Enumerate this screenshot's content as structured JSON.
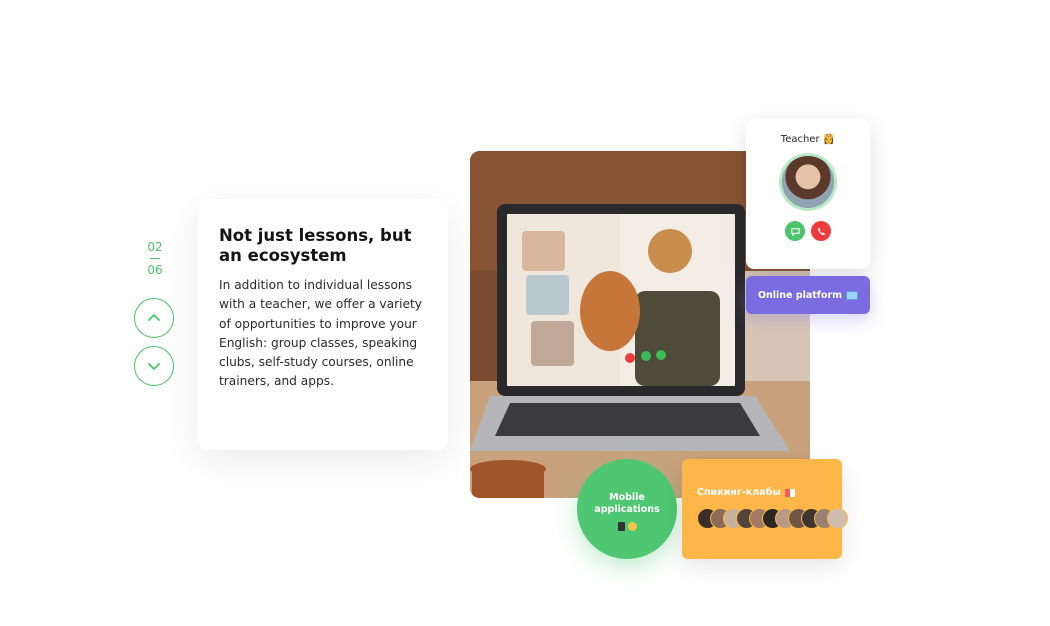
{
  "pager": {
    "current": "02",
    "total": "06"
  },
  "card": {
    "title": "Not just lessons, but an ecosystem",
    "body": "In addition to individual lessons with a teacher, we offer a variety of opportunities to improve your English: group classes, speaking clubs, self-study courses, online trainers, and apps."
  },
  "teacher_card": {
    "title": "Teacher 👸"
  },
  "online_platform": {
    "label": "Online platform"
  },
  "mobile_apps": {
    "label_line1": "Mobile",
    "label_line2": "applications"
  },
  "speaking_clubs": {
    "label": "Спикинг-клабы"
  },
  "colors": {
    "accent_green": "#4cc46b",
    "purple": "#7a6be0",
    "orange": "#fdb748",
    "red": "#ef3b3b"
  },
  "icons": [
    "chevron-up-icon",
    "chevron-down-icon",
    "chat-icon",
    "phone-end-icon",
    "laptop-icon",
    "phone-icon",
    "person-icon",
    "flag-icon"
  ]
}
